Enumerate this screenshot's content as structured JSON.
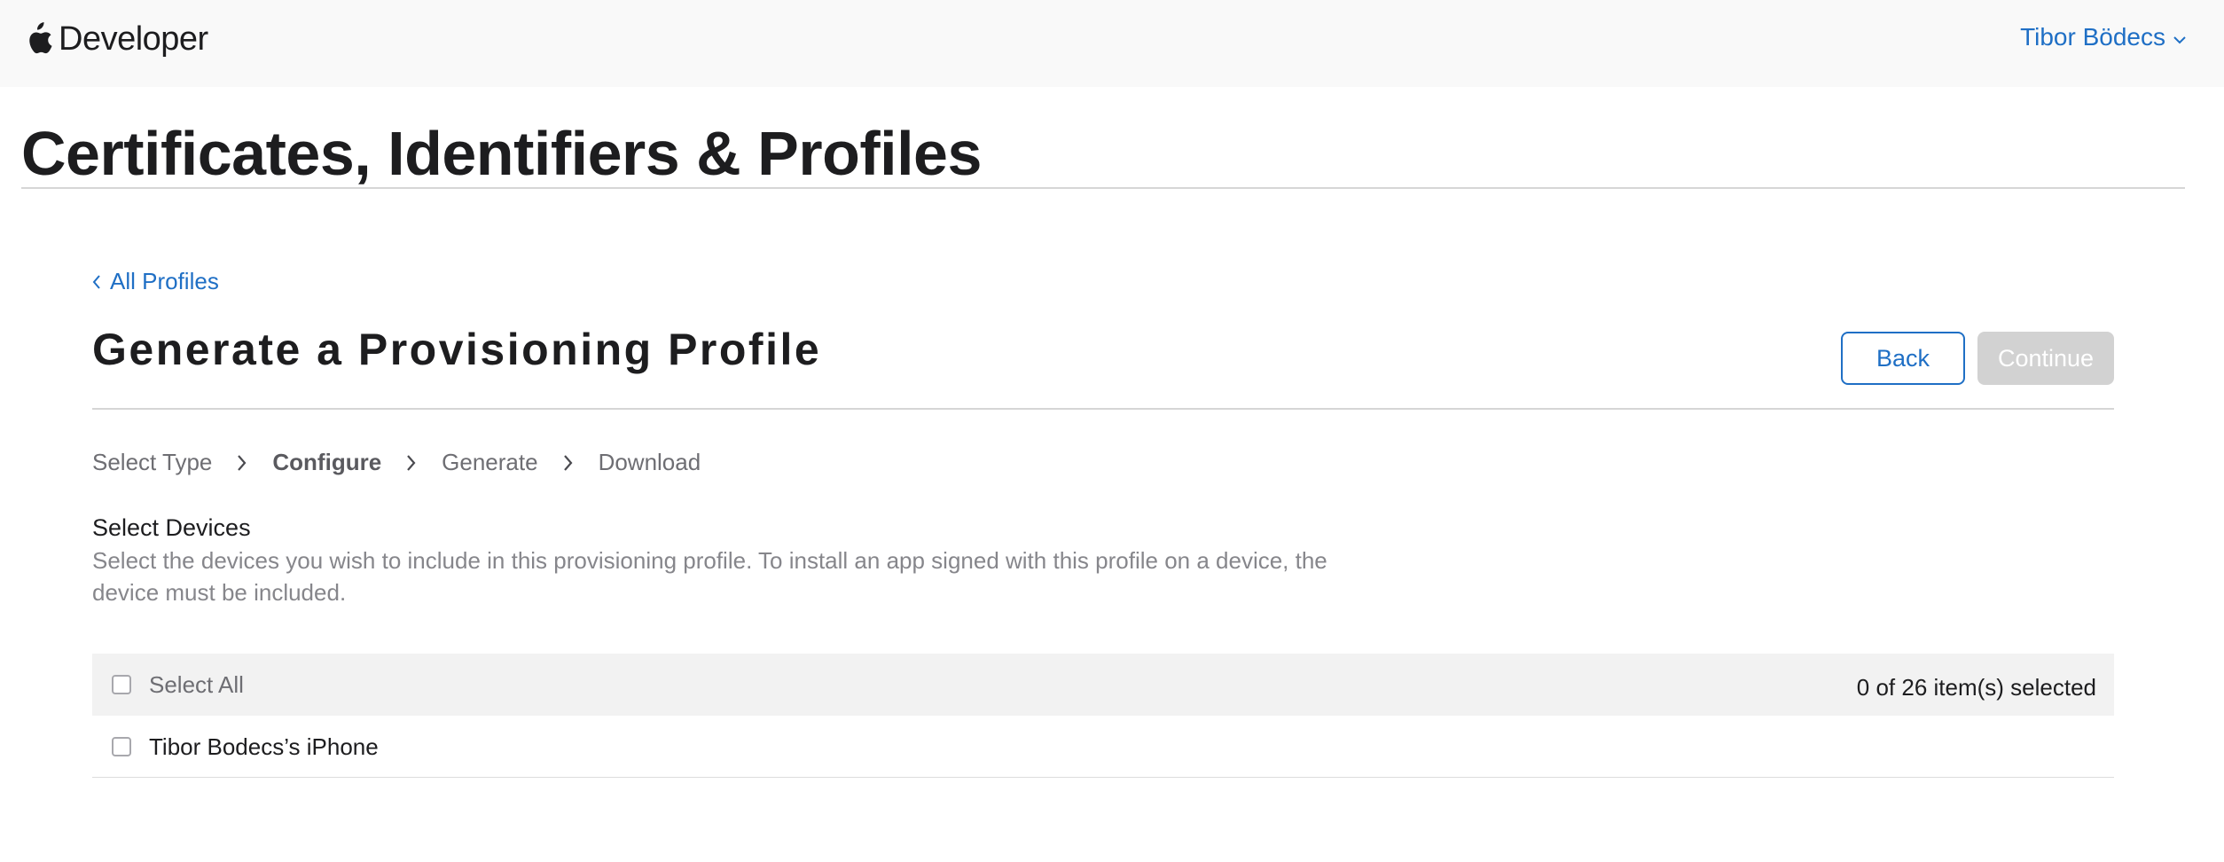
{
  "header": {
    "brand": "Developer",
    "user_name": "Tibor Bödecs"
  },
  "page": {
    "title": "Certificates, Identifiers & Profiles"
  },
  "breadcrumb": {
    "back_label": "All Profiles"
  },
  "section": {
    "title": "Generate a Provisioning Profile",
    "back_button": "Back",
    "continue_button": "Continue"
  },
  "steps": [
    {
      "label": "Select Type",
      "current": false
    },
    {
      "label": "Configure",
      "current": true
    },
    {
      "label": "Generate",
      "current": false
    },
    {
      "label": "Download",
      "current": false
    }
  ],
  "devices": {
    "title": "Select Devices",
    "description": "Select the devices you wish to include in this provisioning profile. To install an app signed with this profile on a device, the device must be included.",
    "select_all_label": "Select All",
    "selected_count": "0 of 26 item(s) selected",
    "items": [
      {
        "name": "Tibor Bodecs’s iPhone",
        "checked": false
      }
    ]
  },
  "colors": {
    "accent": "#1f6fc5",
    "header_bg": "#f9f9f9",
    "disabled_button": "#d2d2d2"
  },
  "icons": {
    "brand": "apple-logo-icon",
    "user_menu": "chevron-down-icon",
    "back": "chevron-left-icon",
    "step_separator": "chevron-right-icon"
  }
}
